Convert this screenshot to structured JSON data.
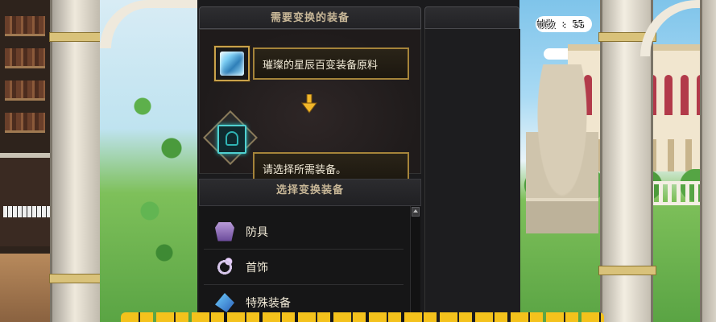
{
  "hud": {
    "fps_text": "帧数 : 55"
  },
  "panel": {
    "tab_left_title": "需要变换的装备",
    "tab_right_title": "",
    "material": {
      "icon": "crystal-gem-icon",
      "label": "璀璨的星辰百变装备原料"
    },
    "arrow_icon": "down-arrow-icon",
    "equipment_slot": {
      "icon": "equipment-slot-icon",
      "label": "请选择所需装备。"
    },
    "select_header": "选择变换装备",
    "categories": [
      {
        "icon": "armor-icon",
        "label": "防具"
      },
      {
        "icon": "ring-icon",
        "label": "首饰"
      },
      {
        "icon": "special-gear-icon",
        "label": "特殊装备"
      }
    ]
  },
  "colors": {
    "gold_border": "#a5843a",
    "title_text": "#c9b898",
    "cyan_glow": "#4fd0d0",
    "caption_yellow": "#f4c21c"
  }
}
